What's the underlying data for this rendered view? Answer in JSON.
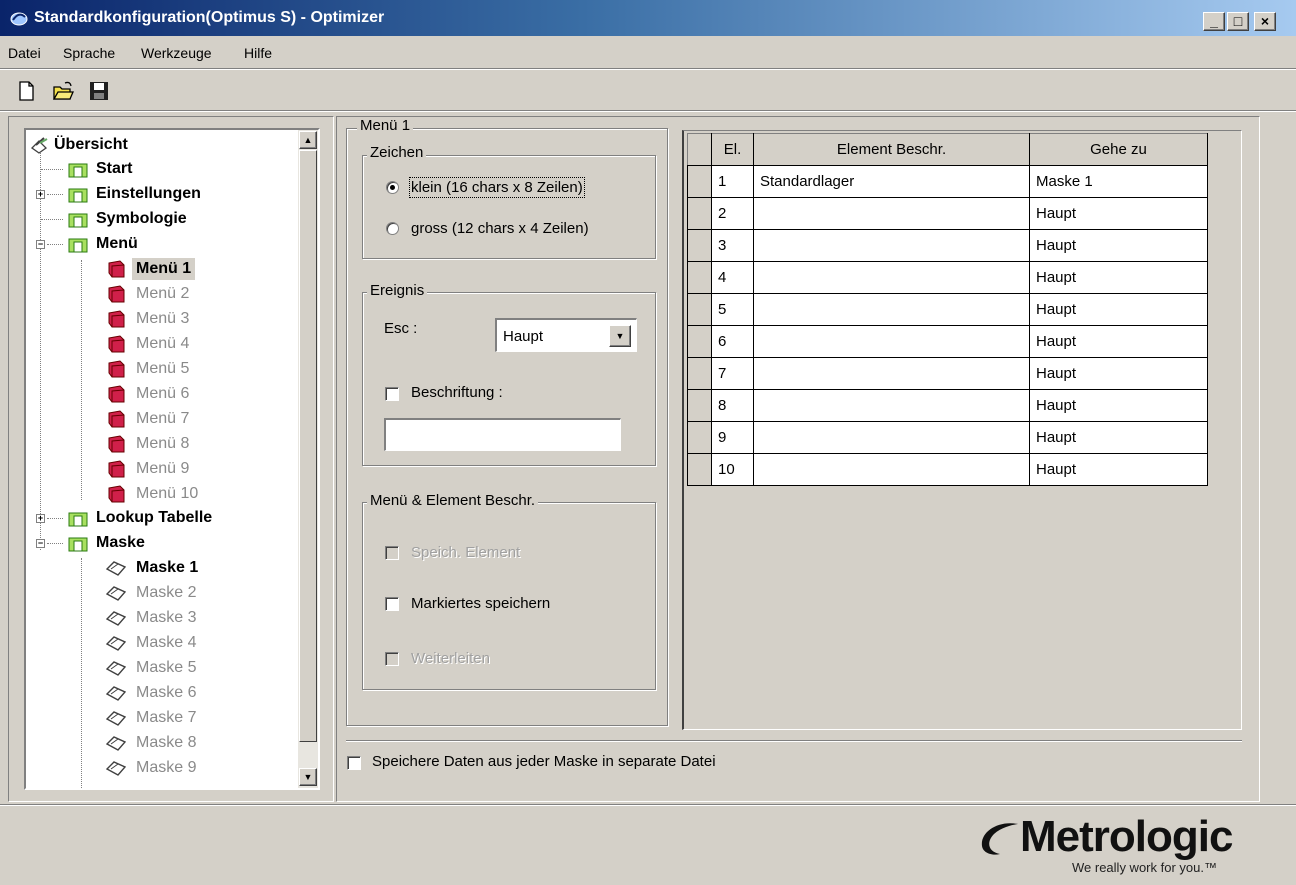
{
  "window": {
    "title": "Standardkonfiguration(Optimus S) - Optimizer",
    "buttons": {
      "minimize": "_",
      "maximize": "□",
      "close": "×"
    }
  },
  "menubar": [
    "Datei",
    "Sprache",
    "Werkzeuge",
    "Hilfe"
  ],
  "toolbar": [
    "new-file-icon",
    "open-folder-icon",
    "save-disk-icon"
  ],
  "tree": {
    "root": "Übersicht",
    "nodes": [
      {
        "label": "Start"
      },
      {
        "label": "Einstellungen"
      },
      {
        "label": "Symbologie"
      },
      {
        "label": "Menü"
      },
      {
        "label": "Menü  1"
      },
      {
        "label": "Menü 2"
      },
      {
        "label": "Menü 3"
      },
      {
        "label": "Menü 4"
      },
      {
        "label": "Menü 5"
      },
      {
        "label": "Menü 6"
      },
      {
        "label": "Menü 7"
      },
      {
        "label": "Menü 8"
      },
      {
        "label": "Menü 9"
      },
      {
        "label": "Menü 10"
      },
      {
        "label": "Lookup Tabelle"
      },
      {
        "label": "Maske"
      },
      {
        "label": "Maske  1"
      },
      {
        "label": "Maske 2"
      },
      {
        "label": "Maske 3"
      },
      {
        "label": "Maske 4"
      },
      {
        "label": "Maske 5"
      },
      {
        "label": "Maske 6"
      },
      {
        "label": "Maske 7"
      },
      {
        "label": "Maske 8"
      },
      {
        "label": "Maske 9"
      }
    ]
  },
  "panel": {
    "title": "Menü 1",
    "zeichen": {
      "legend": "Zeichen",
      "option_small": "klein (16 chars x 8 Zeilen)",
      "option_large": "gross (12 chars x 4 Zeilen)",
      "selected": "small"
    },
    "ereignis": {
      "legend": "Ereignis",
      "esc_label": "Esc :",
      "esc_value": "Haupt",
      "caption_label": "Beschriftung :",
      "caption_checked": false,
      "caption_value": ""
    },
    "beschr": {
      "legend": "Menü & Element Beschr.",
      "speich_element": "Speich. Element",
      "markiertes": "Markiertes speichern",
      "weiterleiten": "Weiterleiten"
    }
  },
  "grid": {
    "headers": [
      "El.",
      "Element Beschr.",
      "Gehe zu"
    ],
    "rows": [
      {
        "el": "1",
        "desc": "Standardlager",
        "goto": "Maske 1"
      },
      {
        "el": "2",
        "desc": "",
        "goto": "Haupt"
      },
      {
        "el": "3",
        "desc": "",
        "goto": "Haupt"
      },
      {
        "el": "4",
        "desc": "",
        "goto": "Haupt"
      },
      {
        "el": "5",
        "desc": "",
        "goto": "Haupt"
      },
      {
        "el": "6",
        "desc": "",
        "goto": "Haupt"
      },
      {
        "el": "7",
        "desc": "",
        "goto": "Haupt"
      },
      {
        "el": "8",
        "desc": "",
        "goto": "Haupt"
      },
      {
        "el": "9",
        "desc": "",
        "goto": "Haupt"
      },
      {
        "el": "10",
        "desc": "",
        "goto": "Haupt"
      }
    ]
  },
  "footer_checkbox": "Speichere Daten aus jeder Maske in separate Datei",
  "logo": {
    "name": "Metrologic",
    "tagline": "We really work for you.™"
  }
}
